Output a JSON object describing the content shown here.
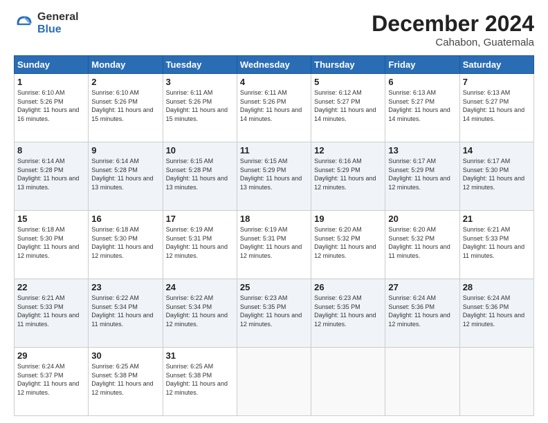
{
  "logo": {
    "general": "General",
    "blue": "Blue"
  },
  "title": "December 2024",
  "location": "Cahabon, Guatemala",
  "days_of_week": [
    "Sunday",
    "Monday",
    "Tuesday",
    "Wednesday",
    "Thursday",
    "Friday",
    "Saturday"
  ],
  "weeks": [
    [
      {
        "day": "1",
        "sunrise": "6:10 AM",
        "sunset": "5:26 PM",
        "daylight": "11 hours and 16 minutes."
      },
      {
        "day": "2",
        "sunrise": "6:10 AM",
        "sunset": "5:26 PM",
        "daylight": "11 hours and 15 minutes."
      },
      {
        "day": "3",
        "sunrise": "6:11 AM",
        "sunset": "5:26 PM",
        "daylight": "11 hours and 15 minutes."
      },
      {
        "day": "4",
        "sunrise": "6:11 AM",
        "sunset": "5:26 PM",
        "daylight": "11 hours and 14 minutes."
      },
      {
        "day": "5",
        "sunrise": "6:12 AM",
        "sunset": "5:27 PM",
        "daylight": "11 hours and 14 minutes."
      },
      {
        "day": "6",
        "sunrise": "6:13 AM",
        "sunset": "5:27 PM",
        "daylight": "11 hours and 14 minutes."
      },
      {
        "day": "7",
        "sunrise": "6:13 AM",
        "sunset": "5:27 PM",
        "daylight": "11 hours and 14 minutes."
      }
    ],
    [
      {
        "day": "8",
        "sunrise": "6:14 AM",
        "sunset": "5:28 PM",
        "daylight": "11 hours and 13 minutes."
      },
      {
        "day": "9",
        "sunrise": "6:14 AM",
        "sunset": "5:28 PM",
        "daylight": "11 hours and 13 minutes."
      },
      {
        "day": "10",
        "sunrise": "6:15 AM",
        "sunset": "5:28 PM",
        "daylight": "11 hours and 13 minutes."
      },
      {
        "day": "11",
        "sunrise": "6:15 AM",
        "sunset": "5:29 PM",
        "daylight": "11 hours and 13 minutes."
      },
      {
        "day": "12",
        "sunrise": "6:16 AM",
        "sunset": "5:29 PM",
        "daylight": "11 hours and 12 minutes."
      },
      {
        "day": "13",
        "sunrise": "6:17 AM",
        "sunset": "5:29 PM",
        "daylight": "11 hours and 12 minutes."
      },
      {
        "day": "14",
        "sunrise": "6:17 AM",
        "sunset": "5:30 PM",
        "daylight": "11 hours and 12 minutes."
      }
    ],
    [
      {
        "day": "15",
        "sunrise": "6:18 AM",
        "sunset": "5:30 PM",
        "daylight": "11 hours and 12 minutes."
      },
      {
        "day": "16",
        "sunrise": "6:18 AM",
        "sunset": "5:30 PM",
        "daylight": "11 hours and 12 minutes."
      },
      {
        "day": "17",
        "sunrise": "6:19 AM",
        "sunset": "5:31 PM",
        "daylight": "11 hours and 12 minutes."
      },
      {
        "day": "18",
        "sunrise": "6:19 AM",
        "sunset": "5:31 PM",
        "daylight": "11 hours and 12 minutes."
      },
      {
        "day": "19",
        "sunrise": "6:20 AM",
        "sunset": "5:32 PM",
        "daylight": "11 hours and 12 minutes."
      },
      {
        "day": "20",
        "sunrise": "6:20 AM",
        "sunset": "5:32 PM",
        "daylight": "11 hours and 11 minutes."
      },
      {
        "day": "21",
        "sunrise": "6:21 AM",
        "sunset": "5:33 PM",
        "daylight": "11 hours and 11 minutes."
      }
    ],
    [
      {
        "day": "22",
        "sunrise": "6:21 AM",
        "sunset": "5:33 PM",
        "daylight": "11 hours and 11 minutes."
      },
      {
        "day": "23",
        "sunrise": "6:22 AM",
        "sunset": "5:34 PM",
        "daylight": "11 hours and 11 minutes."
      },
      {
        "day": "24",
        "sunrise": "6:22 AM",
        "sunset": "5:34 PM",
        "daylight": "11 hours and 12 minutes."
      },
      {
        "day": "25",
        "sunrise": "6:23 AM",
        "sunset": "5:35 PM",
        "daylight": "11 hours and 12 minutes."
      },
      {
        "day": "26",
        "sunrise": "6:23 AM",
        "sunset": "5:35 PM",
        "daylight": "11 hours and 12 minutes."
      },
      {
        "day": "27",
        "sunrise": "6:24 AM",
        "sunset": "5:36 PM",
        "daylight": "11 hours and 12 minutes."
      },
      {
        "day": "28",
        "sunrise": "6:24 AM",
        "sunset": "5:36 PM",
        "daylight": "11 hours and 12 minutes."
      }
    ],
    [
      {
        "day": "29",
        "sunrise": "6:24 AM",
        "sunset": "5:37 PM",
        "daylight": "11 hours and 12 minutes."
      },
      {
        "day": "30",
        "sunrise": "6:25 AM",
        "sunset": "5:38 PM",
        "daylight": "11 hours and 12 minutes."
      },
      {
        "day": "31",
        "sunrise": "6:25 AM",
        "sunset": "5:38 PM",
        "daylight": "11 hours and 12 minutes."
      },
      null,
      null,
      null,
      null
    ]
  ],
  "labels": {
    "sunrise": "Sunrise:",
    "sunset": "Sunset:",
    "daylight": "Daylight:"
  }
}
